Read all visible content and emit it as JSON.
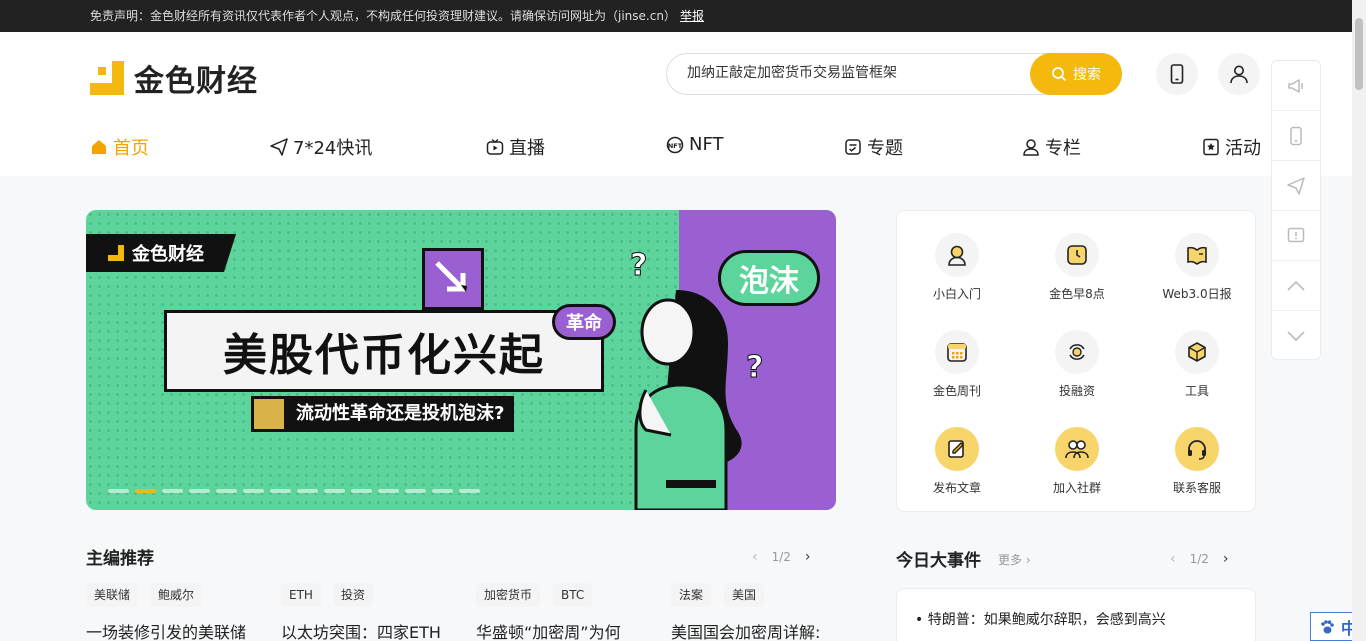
{
  "topbar": {
    "disclaimer": "免责声明：金色财经所有资讯仅代表作者个人观点，不构成任何投资理财建议。请确保访问网址为（jinse.cn）",
    "report": "举报"
  },
  "header": {
    "logo_text": "金色财经",
    "search_value": "加纳正敲定加密货币交易监管框架",
    "search_button": "搜索"
  },
  "nav": [
    {
      "label": "首页",
      "icon": "home-icon"
    },
    {
      "label": "7*24快讯",
      "icon": "send-icon"
    },
    {
      "label": "直播",
      "icon": "tv-icon"
    },
    {
      "label": "NFT",
      "icon": "nft-icon"
    },
    {
      "label": "专题",
      "icon": "topic-icon"
    },
    {
      "label": "专栏",
      "icon": "column-icon"
    },
    {
      "label": "活动",
      "icon": "activity-icon"
    }
  ],
  "banner": {
    "logo_text": "金色财经",
    "title": "美股代币化兴起",
    "subtitle": "流动性革命还是投机泡沫?",
    "bubble_big": "泡沫",
    "bubble_small": "革命",
    "slide_count": 14,
    "active_slide": 1
  },
  "quick": [
    {
      "label": "小白入门",
      "icon": "user-guide-icon"
    },
    {
      "label": "金色早8点",
      "icon": "clock-icon"
    },
    {
      "label": "Web3.0日报",
      "icon": "book-icon"
    },
    {
      "label": "金色周刊",
      "icon": "calendar-icon"
    },
    {
      "label": "投融资",
      "icon": "invest-icon"
    },
    {
      "label": "工具",
      "icon": "tools-icon"
    },
    {
      "label": "发布文章",
      "icon": "edit-icon"
    },
    {
      "label": "加入社群",
      "icon": "group-icon"
    },
    {
      "label": "联系客服",
      "icon": "headset-icon"
    }
  ],
  "editor_picks": {
    "title": "主编推荐",
    "pager": "1/2",
    "cards": [
      {
        "tags": [
          "美联储",
          "鲍威尔"
        ],
        "title": "一场装修引发的美联储"
      },
      {
        "tags": [
          "ETH",
          "投资"
        ],
        "title": "以太坊突围：四家ETH"
      },
      {
        "tags": [
          "加密货币",
          "BTC"
        ],
        "title": "华盛顿“加密周”为何"
      },
      {
        "tags": [
          "法案",
          "美国"
        ],
        "title": "美国国会加密周详解:"
      }
    ]
  },
  "events": {
    "title": "今日大事件",
    "more": "更多",
    "pager": "1/2",
    "items": [
      "特朗普：如果鲍威尔辞职，会感到高兴"
    ]
  },
  "lang_badge": "中",
  "colors": {
    "accent": "#f5b80c",
    "banner_green": "#5dd49b",
    "banner_purple": "#9a5fd0"
  }
}
